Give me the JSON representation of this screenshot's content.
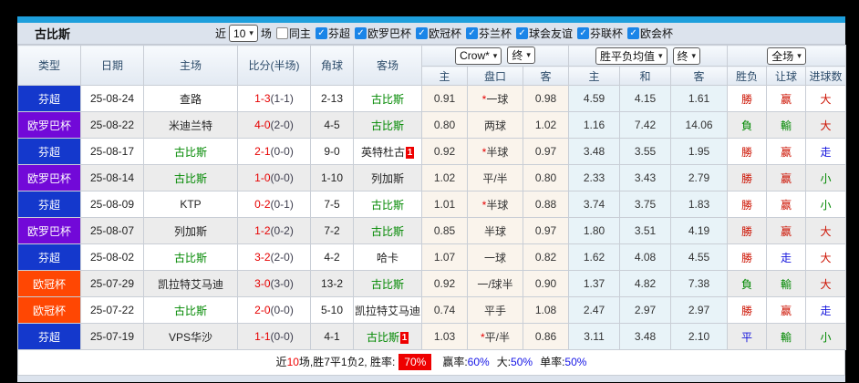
{
  "frame": {
    "accent_bar_color": "#1e9fdc"
  },
  "titlebar": {
    "team": "古比斯",
    "recent_prefix": "近",
    "recent_value": "10",
    "recent_suffix": "场",
    "filters": [
      {
        "label": "同主",
        "checked": false
      },
      {
        "label": "芬超",
        "checked": true
      },
      {
        "label": "欧罗巴杯",
        "checked": true
      },
      {
        "label": "欧冠杯",
        "checked": true
      },
      {
        "label": "芬兰杯",
        "checked": true
      },
      {
        "label": "球会友谊",
        "checked": true
      },
      {
        "label": "芬联杯",
        "checked": true
      },
      {
        "label": "欧会杯",
        "checked": true
      }
    ]
  },
  "table": {
    "main_columns": [
      "类型",
      "日期",
      "主场",
      "比分(半场)",
      "角球",
      "客场"
    ],
    "selects": {
      "company": "Crow*",
      "company_time": "终",
      "avg": "胜平负均值",
      "avg_time": "终",
      "scope": "全场"
    },
    "sub_columns": [
      "主",
      "盘口",
      "客",
      "主",
      "和",
      "客",
      "胜负",
      "让球",
      "进球数"
    ],
    "league_colors": {
      "芬超": "#1438cc",
      "欧罗巴杯": "#7209d8",
      "欧冠杯": "#ff4703"
    },
    "rows": [
      {
        "league": "芬超",
        "date": "25-08-24",
        "home": "查路",
        "home_team": false,
        "home_rc": "",
        "ft": "1-3",
        "ht": "(1-1)",
        "corners": "2-13",
        "away": "古比斯",
        "away_team": true,
        "away_rc": "",
        "odds_home": "0.91",
        "star": "*",
        "handicap": "一球",
        "odds_away": "0.98",
        "avg_home": "4.59",
        "avg_draw": "4.15",
        "avg_away": "1.61",
        "results": [
          [
            "勝",
            "red"
          ],
          [
            "赢",
            "red"
          ],
          [
            "大",
            "red"
          ]
        ]
      },
      {
        "league": "欧罗巴杯",
        "date": "25-08-22",
        "home": "米迪兰特",
        "home_team": false,
        "home_rc": "",
        "ft": "4-0",
        "ht": "(2-0)",
        "corners": "4-5",
        "away": "古比斯",
        "away_team": true,
        "away_rc": "",
        "odds_home": "0.80",
        "star": "",
        "handicap": "两球",
        "odds_away": "1.02",
        "avg_home": "1.16",
        "avg_draw": "7.42",
        "avg_away": "14.06",
        "results": [
          [
            "負",
            "green"
          ],
          [
            "輸",
            "green"
          ],
          [
            "大",
            "red"
          ]
        ]
      },
      {
        "league": "芬超",
        "date": "25-08-17",
        "home": "古比斯",
        "home_team": true,
        "home_rc": "",
        "ft": "2-1",
        "ht": "(0-0)",
        "corners": "9-0",
        "away": "英特杜古",
        "away_team": false,
        "away_rc": "1",
        "odds_home": "0.92",
        "star": "*",
        "handicap": "半球",
        "odds_away": "0.97",
        "avg_home": "3.48",
        "avg_draw": "3.55",
        "avg_away": "1.95",
        "results": [
          [
            "勝",
            "red"
          ],
          [
            "赢",
            "red"
          ],
          [
            "走",
            "blue"
          ]
        ]
      },
      {
        "league": "欧罗巴杯",
        "date": "25-08-14",
        "home": "古比斯",
        "home_team": true,
        "home_rc": "",
        "ft": "1-0",
        "ht": "(0-0)",
        "corners": "1-10",
        "away": "列加斯",
        "away_team": false,
        "away_rc": "",
        "odds_home": "1.02",
        "star": "",
        "handicap": "平/半",
        "odds_away": "0.80",
        "avg_home": "2.33",
        "avg_draw": "3.43",
        "avg_away": "2.79",
        "results": [
          [
            "勝",
            "red"
          ],
          [
            "赢",
            "red"
          ],
          [
            "小",
            "green"
          ]
        ]
      },
      {
        "league": "芬超",
        "date": "25-08-09",
        "home": "KTP",
        "home_team": false,
        "home_rc": "",
        "ft": "0-2",
        "ht": "(0-1)",
        "corners": "7-5",
        "away": "古比斯",
        "away_team": true,
        "away_rc": "",
        "odds_home": "1.01",
        "star": "*",
        "handicap": "半球",
        "odds_away": "0.88",
        "avg_home": "3.74",
        "avg_draw": "3.75",
        "avg_away": "1.83",
        "results": [
          [
            "勝",
            "red"
          ],
          [
            "赢",
            "red"
          ],
          [
            "小",
            "green"
          ]
        ]
      },
      {
        "league": "欧罗巴杯",
        "date": "25-08-07",
        "home": "列加斯",
        "home_team": false,
        "home_rc": "",
        "ft": "1-2",
        "ht": "(0-2)",
        "corners": "7-2",
        "away": "古比斯",
        "away_team": true,
        "away_rc": "",
        "odds_home": "0.85",
        "star": "",
        "handicap": "半球",
        "odds_away": "0.97",
        "avg_home": "1.80",
        "avg_draw": "3.51",
        "avg_away": "4.19",
        "results": [
          [
            "勝",
            "red"
          ],
          [
            "赢",
            "red"
          ],
          [
            "大",
            "red"
          ]
        ]
      },
      {
        "league": "芬超",
        "date": "25-08-02",
        "home": "古比斯",
        "home_team": true,
        "home_rc": "",
        "ft": "3-2",
        "ht": "(2-0)",
        "corners": "4-2",
        "away": "哈卡",
        "away_team": false,
        "away_rc": "",
        "odds_home": "1.07",
        "star": "",
        "handicap": "一球",
        "odds_away": "0.82",
        "avg_home": "1.62",
        "avg_draw": "4.08",
        "avg_away": "4.55",
        "results": [
          [
            "勝",
            "red"
          ],
          [
            "走",
            "blue"
          ],
          [
            "大",
            "red"
          ]
        ]
      },
      {
        "league": "欧冠杯",
        "date": "25-07-29",
        "home": "凯拉特艾马迪",
        "home_team": false,
        "home_rc": "",
        "ft": "3-0",
        "ht": "(3-0)",
        "corners": "13-2",
        "away": "古比斯",
        "away_team": true,
        "away_rc": "",
        "odds_home": "0.92",
        "star": "",
        "handicap": "一/球半",
        "odds_away": "0.90",
        "avg_home": "1.37",
        "avg_draw": "4.82",
        "avg_away": "7.38",
        "results": [
          [
            "負",
            "green"
          ],
          [
            "輸",
            "green"
          ],
          [
            "大",
            "red"
          ]
        ]
      },
      {
        "league": "欧冠杯",
        "date": "25-07-22",
        "home": "古比斯",
        "home_team": true,
        "home_rc": "",
        "ft": "2-0",
        "ht": "(0-0)",
        "corners": "5-10",
        "away": "凯拉特艾马迪",
        "away_team": false,
        "away_rc": "",
        "odds_home": "0.74",
        "star": "",
        "handicap": "平手",
        "odds_away": "1.08",
        "avg_home": "2.47",
        "avg_draw": "2.97",
        "avg_away": "2.97",
        "results": [
          [
            "勝",
            "red"
          ],
          [
            "赢",
            "red"
          ],
          [
            "走",
            "blue"
          ]
        ]
      },
      {
        "league": "芬超",
        "date": "25-07-19",
        "home": "VPS华沙",
        "home_team": false,
        "home_rc": "",
        "ft": "1-1",
        "ht": "(0-0)",
        "corners": "4-1",
        "away": "古比斯",
        "away_team": true,
        "away_rc": "1",
        "odds_home": "1.03",
        "star": "*",
        "handicap": "平/半",
        "odds_away": "0.86",
        "avg_home": "3.11",
        "avg_draw": "3.48",
        "avg_away": "2.10",
        "results": [
          [
            "平",
            "blue"
          ],
          [
            "輸",
            "green"
          ],
          [
            "小",
            "green"
          ]
        ]
      }
    ]
  },
  "summary": {
    "prefix": "近",
    "count": "10",
    "mid": "场,胜7平1负2, 胜率:",
    "win_rate": "70%",
    "seg2_label": "赢率:",
    "seg2_value": "60%",
    "seg3_label": "大:",
    "seg3_value": "50%",
    "seg4_label": "单率:",
    "seg4_value": "50%"
  }
}
